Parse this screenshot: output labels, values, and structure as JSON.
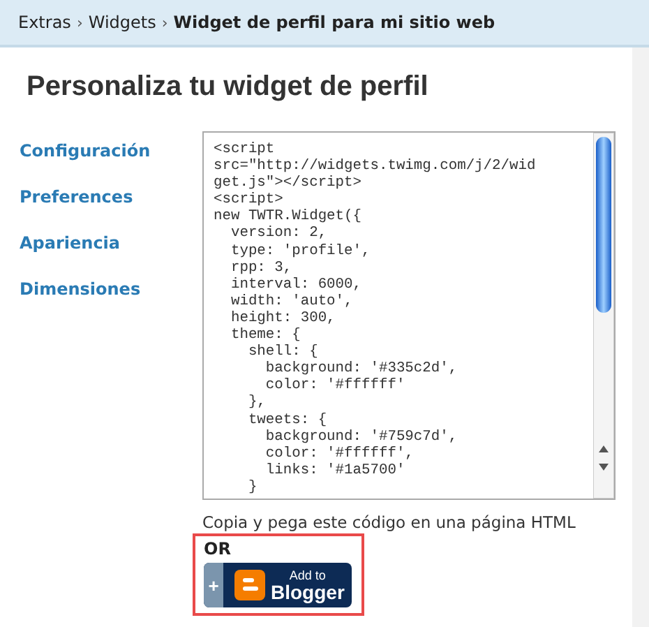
{
  "breadcrumb": [
    "Extras",
    "Widgets",
    "Widget de perfil para mi sitio web"
  ],
  "breadcrumb_separator": "›",
  "title": "Personaliza tu widget de perfil",
  "sidebar": {
    "items": [
      {
        "label": "Configuración"
      },
      {
        "label": "Preferences"
      },
      {
        "label": "Apariencia"
      },
      {
        "label": "Dimensiones"
      }
    ]
  },
  "code": "<script\nsrc=\"http://widgets.twimg.com/j/2/wid\nget.js\"></script>\n<script>\nnew TWTR.Widget({\n  version: 2,\n  type: 'profile',\n  rpp: 3,\n  interval: 6000,\n  width: 'auto',\n  height: 300,\n  theme: {\n    shell: {\n      background: '#335c2d',\n      color: '#ffffff'\n    },\n    tweets: {\n      background: '#759c7d',\n      color: '#ffffff',\n      links: '#1a5700'\n    }",
  "hint": "Copia y pega este código en una página HTML",
  "or_label": "OR",
  "blogger_button": {
    "plus": "+",
    "line_1": "Add to",
    "line_2": "Blogger"
  }
}
